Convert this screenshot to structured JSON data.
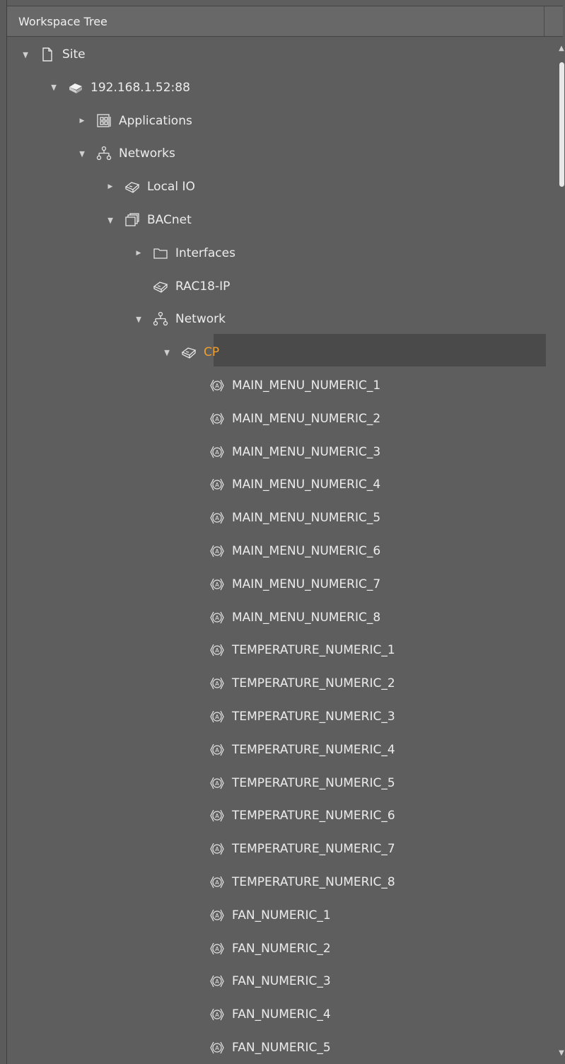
{
  "panel": {
    "title": "Workspace Tree"
  },
  "tree": [
    {
      "label": "Site",
      "depth": 0,
      "toggle": "expanded",
      "icon": "page-icon"
    },
    {
      "label": "192.168.1.52:88",
      "depth": 1,
      "toggle": "expanded",
      "icon": "device-icon"
    },
    {
      "label": "Applications",
      "depth": 2,
      "toggle": "collapsed",
      "icon": "applications-icon"
    },
    {
      "label": "Networks",
      "depth": 2,
      "toggle": "expanded",
      "icon": "network-icon"
    },
    {
      "label": "Local IO",
      "depth": 3,
      "toggle": "collapsed",
      "icon": "module-icon"
    },
    {
      "label": "BACnet",
      "depth": 3,
      "toggle": "expanded",
      "icon": "stack-icon"
    },
    {
      "label": "Interfaces",
      "depth": 4,
      "toggle": "collapsed",
      "icon": "folder-icon"
    },
    {
      "label": "RAC18-IP",
      "depth": 4,
      "toggle": "none",
      "icon": "module-icon"
    },
    {
      "label": "Network",
      "depth": 4,
      "toggle": "expanded",
      "icon": "network-icon"
    },
    {
      "label": "CP",
      "depth": 5,
      "toggle": "expanded",
      "icon": "module-icon",
      "selected": true
    },
    {
      "label": "MAIN_MENU_NUMERIC_1",
      "depth": 6,
      "toggle": "none",
      "icon": "analog-point-icon"
    },
    {
      "label": "MAIN_MENU_NUMERIC_2",
      "depth": 6,
      "toggle": "none",
      "icon": "analog-point-icon"
    },
    {
      "label": "MAIN_MENU_NUMERIC_3",
      "depth": 6,
      "toggle": "none",
      "icon": "analog-point-icon"
    },
    {
      "label": "MAIN_MENU_NUMERIC_4",
      "depth": 6,
      "toggle": "none",
      "icon": "analog-point-icon"
    },
    {
      "label": "MAIN_MENU_NUMERIC_5",
      "depth": 6,
      "toggle": "none",
      "icon": "analog-point-icon"
    },
    {
      "label": "MAIN_MENU_NUMERIC_6",
      "depth": 6,
      "toggle": "none",
      "icon": "analog-point-icon"
    },
    {
      "label": "MAIN_MENU_NUMERIC_7",
      "depth": 6,
      "toggle": "none",
      "icon": "analog-point-icon"
    },
    {
      "label": "MAIN_MENU_NUMERIC_8",
      "depth": 6,
      "toggle": "none",
      "icon": "analog-point-icon"
    },
    {
      "label": "TEMPERATURE_NUMERIC_1",
      "depth": 6,
      "toggle": "none",
      "icon": "analog-point-icon"
    },
    {
      "label": "TEMPERATURE_NUMERIC_2",
      "depth": 6,
      "toggle": "none",
      "icon": "analog-point-icon"
    },
    {
      "label": "TEMPERATURE_NUMERIC_3",
      "depth": 6,
      "toggle": "none",
      "icon": "analog-point-icon"
    },
    {
      "label": "TEMPERATURE_NUMERIC_4",
      "depth": 6,
      "toggle": "none",
      "icon": "analog-point-icon"
    },
    {
      "label": "TEMPERATURE_NUMERIC_5",
      "depth": 6,
      "toggle": "none",
      "icon": "analog-point-icon"
    },
    {
      "label": "TEMPERATURE_NUMERIC_6",
      "depth": 6,
      "toggle": "none",
      "icon": "analog-point-icon"
    },
    {
      "label": "TEMPERATURE_NUMERIC_7",
      "depth": 6,
      "toggle": "none",
      "icon": "analog-point-icon"
    },
    {
      "label": "TEMPERATURE_NUMERIC_8",
      "depth": 6,
      "toggle": "none",
      "icon": "analog-point-icon"
    },
    {
      "label": "FAN_NUMERIC_1",
      "depth": 6,
      "toggle": "none",
      "icon": "analog-point-icon"
    },
    {
      "label": "FAN_NUMERIC_2",
      "depth": 6,
      "toggle": "none",
      "icon": "analog-point-icon"
    },
    {
      "label": "FAN_NUMERIC_3",
      "depth": 6,
      "toggle": "none",
      "icon": "analog-point-icon"
    },
    {
      "label": "FAN_NUMERIC_4",
      "depth": 6,
      "toggle": "none",
      "icon": "analog-point-icon"
    },
    {
      "label": "FAN_NUMERIC_5",
      "depth": 6,
      "toggle": "none",
      "icon": "analog-point-icon"
    }
  ],
  "colors": {
    "selected_text": "#f0a030",
    "selected_row": "#4a4a4a"
  }
}
